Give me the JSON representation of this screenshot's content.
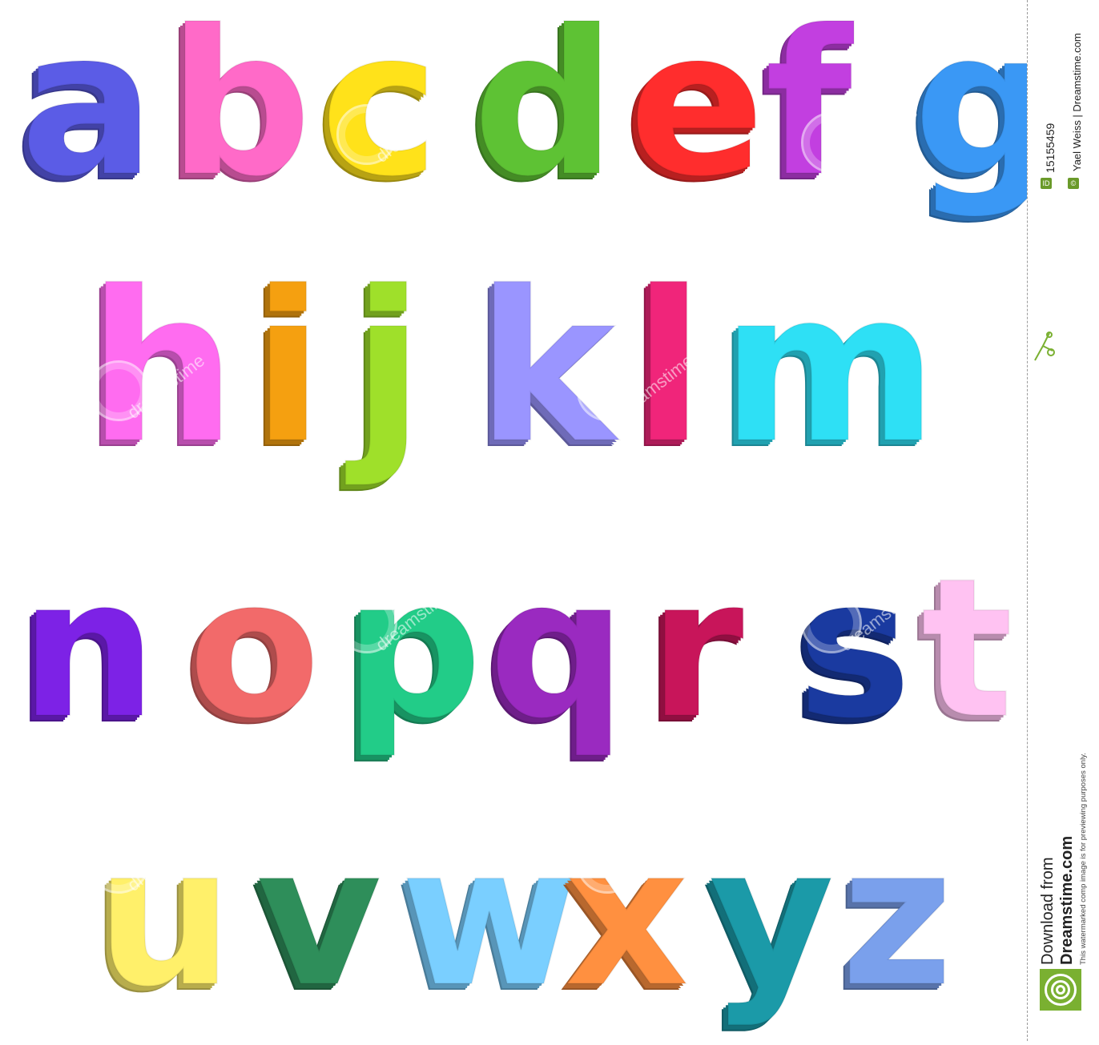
{
  "rows": [
    {
      "letters": [
        {
          "char": "a",
          "color": "#5b5ce6"
        },
        {
          "char": "b",
          "color": "#ff6ac8"
        },
        {
          "char": "c",
          "color": "#ffe21a"
        },
        {
          "char": "d",
          "color": "#5ec234"
        },
        {
          "char": "e",
          "color": "#ff2d2d"
        },
        {
          "char": "f",
          "color": "#c23fe0"
        },
        {
          "char": "g",
          "color": "#3a98f5"
        }
      ]
    },
    {
      "letters": [
        {
          "char": "h",
          "color": "#ff6cf0"
        },
        {
          "char": "i",
          "color": "#f5a010"
        },
        {
          "char": "j",
          "color": "#9fe02a"
        },
        {
          "char": "k",
          "color": "#9a95ff"
        },
        {
          "char": "l",
          "color": "#f0257a"
        },
        {
          "char": "m",
          "color": "#2ee0f5"
        }
      ]
    },
    {
      "letters": [
        {
          "char": "n",
          "color": "#7d22e6"
        },
        {
          "char": "o",
          "color": "#f26a6a"
        },
        {
          "char": "p",
          "color": "#22cc88"
        },
        {
          "char": "q",
          "color": "#9a2ac0"
        },
        {
          "char": "r",
          "color": "#c8155a"
        },
        {
          "char": "s",
          "color": "#1a3aa0"
        },
        {
          "char": "t",
          "color": "#ffc2f2"
        }
      ]
    },
    {
      "letters": [
        {
          "char": "u",
          "color": "#fff06a"
        },
        {
          "char": "v",
          "color": "#2e8e5a"
        },
        {
          "char": "w",
          "color": "#7acfff"
        },
        {
          "char": "x",
          "color": "#ff9040"
        },
        {
          "char": "y",
          "color": "#1b9aa8"
        },
        {
          "char": "z",
          "color": "#7aa0ec"
        }
      ]
    }
  ],
  "watermark": {
    "text": "dreamstime"
  },
  "side": {
    "id": "15155459",
    "author": "Yael Weiss | Dreamstime.com",
    "download": "Download from",
    "site": "Dreamstime.com",
    "notice": "This watermarked comp image is for previewing purposes only.",
    "id_badge": "ID",
    "copyright_badge": "©"
  },
  "colors": {
    "logo_green": "#7ab031",
    "background": "#ffffff"
  }
}
